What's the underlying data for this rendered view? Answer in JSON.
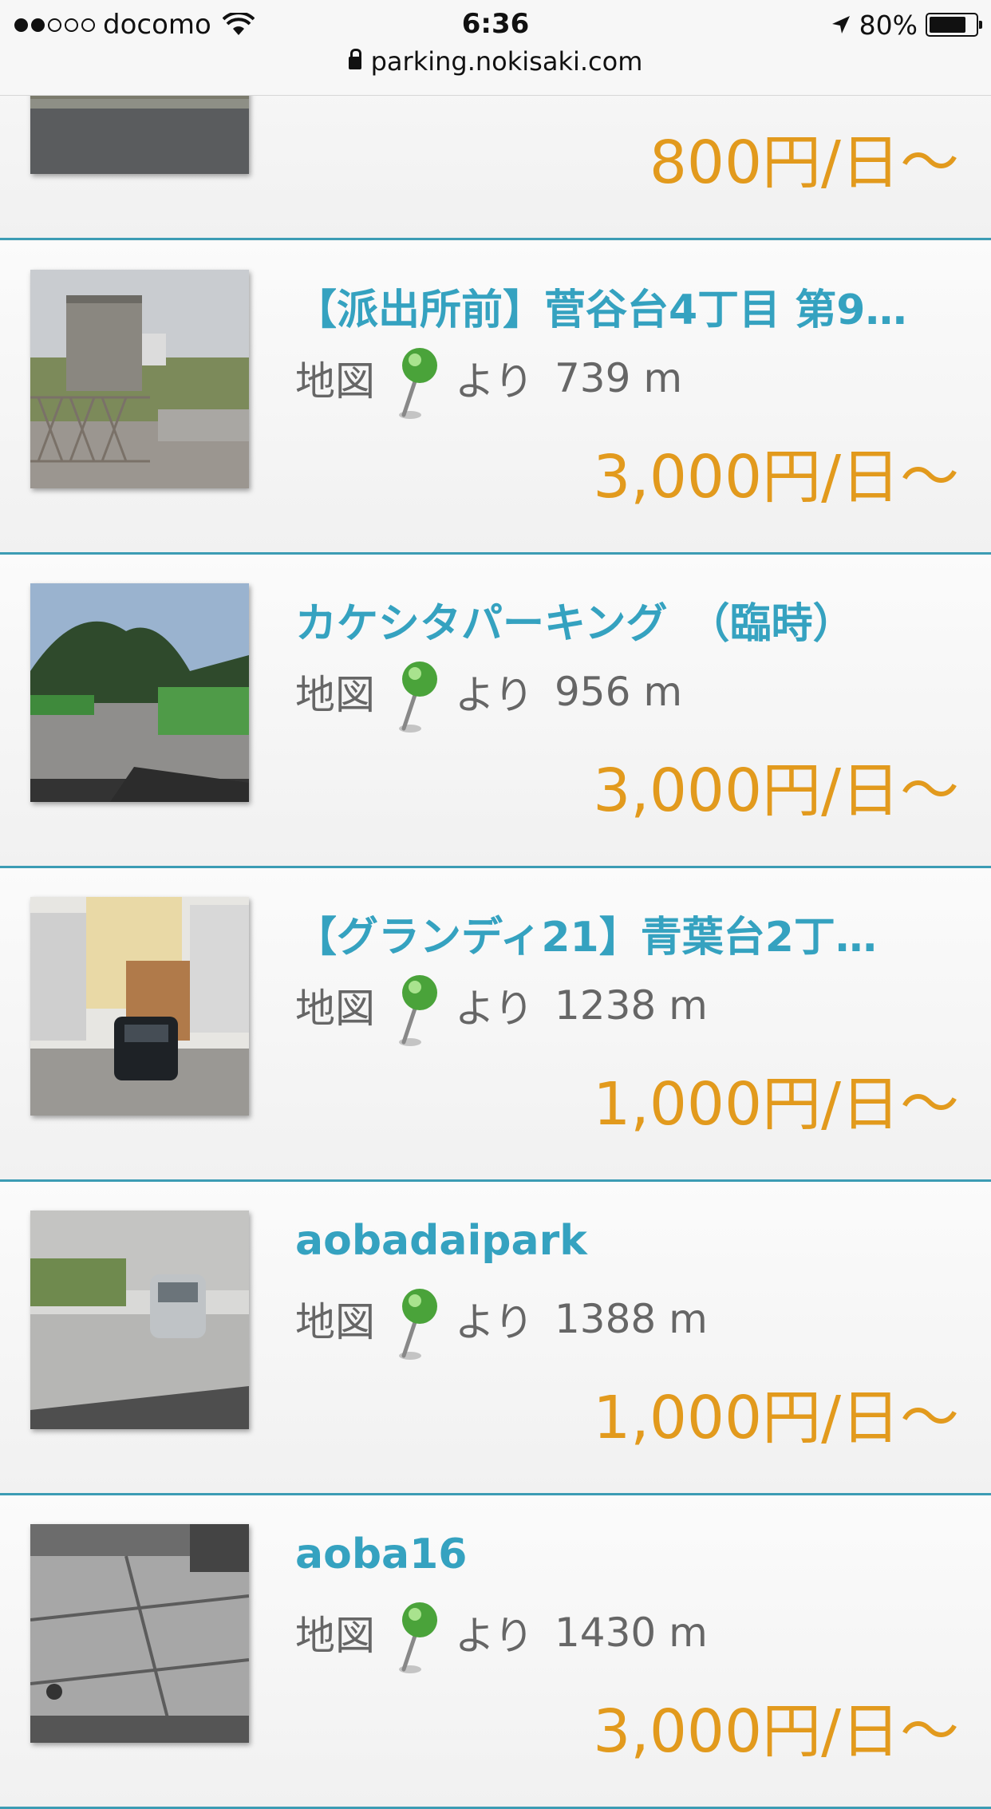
{
  "status_bar": {
    "carrier": "docomo",
    "time": "6:36",
    "battery": "80%",
    "battery_level": 0.8,
    "signal_icon": "signal-dots-icon",
    "wifi_icon": "wifi-icon",
    "location_icon": "location-arrow-icon"
  },
  "url_bar": {
    "url": "parking.nokisaki.com",
    "lock_icon": "lock-icon"
  },
  "colors": {
    "title": "#35a2c0",
    "price": "#e29a1d",
    "text": "#666666",
    "divider": "#3c9cb4"
  },
  "listings": [
    {
      "title": "",
      "map_label": "",
      "from_label": "",
      "distance": "",
      "price": "800円/日～"
    },
    {
      "title": "【派出所前】菅谷台4丁目 第9…",
      "map_label": "地図",
      "from_label": "より",
      "distance": "739 m",
      "price": "3,000円/日～"
    },
    {
      "title": "カケシタパーキング　（臨時）",
      "map_label": "地図",
      "from_label": "より",
      "distance": "956 m",
      "price": "3,000円/日～"
    },
    {
      "title": "【グランディ21】青葉台2丁…",
      "map_label": "地図",
      "from_label": "より",
      "distance": "1238 m",
      "price": "1,000円/日～"
    },
    {
      "title": "aobadaipark",
      "map_label": "地図",
      "from_label": "より",
      "distance": "1388 m",
      "price": "1,000円/日～"
    },
    {
      "title": "aoba16",
      "map_label": "地図",
      "from_label": "より",
      "distance": "1430 m",
      "price": "3,000円/日～"
    }
  ]
}
